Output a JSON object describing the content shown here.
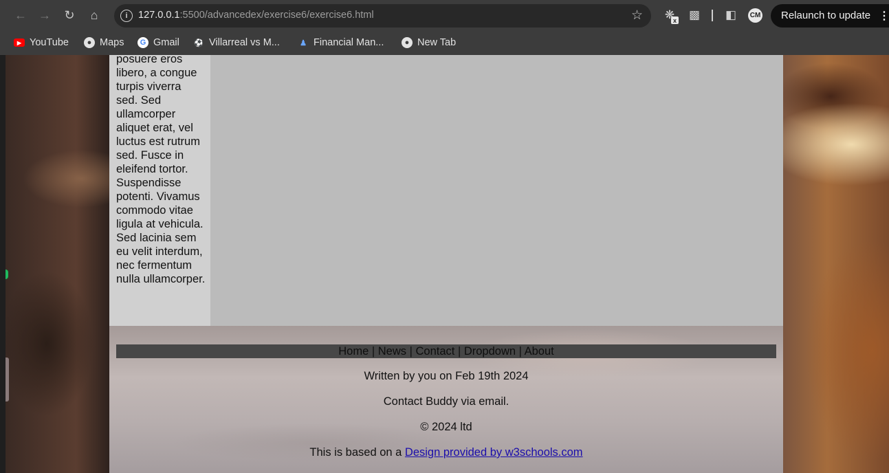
{
  "browser": {
    "url_host": "127.0.0.1",
    "url_path": ":5500/advancedex/exercise6/exercise6.html",
    "relaunch_label": "Relaunch to update",
    "avatar_initials": "CM",
    "bookmarks": [
      {
        "label": "YouTube",
        "icon": "youtube-icon"
      },
      {
        "label": "Maps",
        "icon": "globe-icon"
      },
      {
        "label": "Gmail",
        "icon": "google-icon"
      },
      {
        "label": "Villarreal vs M...",
        "icon": "soccer-ball-icon"
      },
      {
        "label": "Financial Man...",
        "icon": "people-icon"
      },
      {
        "label": "New Tab",
        "icon": "globe-icon"
      }
    ]
  },
  "page": {
    "sidebar_text": "posuere eros libero, a congue turpis viverra sed. Sed ullamcorper aliquet erat, vel luctus est rutrum sed. Fusce in eleifend tortor. Suspendisse potenti. Vivamus commodo vitae ligula at vehicula. Sed lacinia sem eu velit interdum, nec fermentum nulla ullamcorper.",
    "footer": {
      "nav": [
        "Home",
        "News",
        "Contact",
        "Dropdown",
        "About"
      ],
      "separator": " | ",
      "written_by": "Written by you on Feb 19th 2024",
      "contact": "Contact Buddy via email.",
      "copyright": "© 2024 ltd",
      "based_on_prefix": "This is based on a ",
      "based_on_link": "Design provided by w3schools.com"
    }
  }
}
